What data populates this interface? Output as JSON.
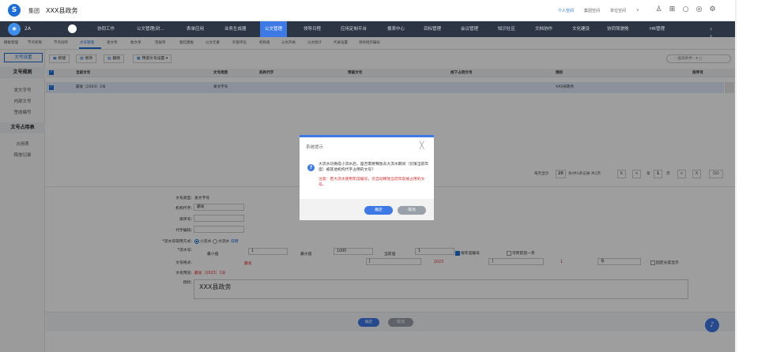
{
  "topbar": {
    "brand": "集团",
    "org": "XXX县政务",
    "links": [
      "个人空间",
      "集团空间",
      "单位空间"
    ],
    "dropdown": "∨"
  },
  "navbar": {
    "avatar": "2A",
    "items": [
      "协同工作",
      "公文管理(封...",
      "表单应用",
      "业务生成器",
      "公文管理",
      "领导日程",
      "应用定制平台",
      "报表中心",
      "目标管理",
      "会议管理",
      "知识社区",
      "文档协作",
      "文化建设",
      "协同驾驶舱",
      "HR管理"
    ],
    "active_index": 4,
    "arrows": "‹ ›"
  },
  "subtabs": {
    "items": [
      "模板管理",
      "节点权限",
      "节点动作",
      "文号管理",
      "发文单",
      "收文单",
      "签报单",
      "套红模板",
      "公文元素",
      "外部单位",
      "机构组",
      "公文开关",
      "公文统计",
      "代录设置",
      "领导批示编号"
    ],
    "active_index": 3
  },
  "sidebar": {
    "tab": "文号设置",
    "group1": "文号规则",
    "group1_items": [
      "发文字号",
      "内部文号",
      "签收编号"
    ],
    "group2": "文号占用表",
    "group2_items": [
      "占用表",
      "释放记录"
    ]
  },
  "toolbar": {
    "new": "新建",
    "edit": "修改",
    "delete": "删除",
    "preset": "预留文号设置",
    "search": "--查询条件--"
  },
  "table": {
    "headers": [
      "当前文号",
      "文号类型",
      "机构代字",
      "预留文号",
      "线下占用文号",
      "授权",
      "排序号"
    ],
    "rows": [
      [
        "霸发〔2023〕2号",
        "发文字号",
        "",
        "",
        "",
        "XXX县政务",
        ""
      ]
    ]
  },
  "pagination": {
    "per_page_label": "每页显示",
    "per_page": "20",
    "summary": "条/共1条记录 共1页",
    "first": "K",
    "prev": "<",
    "page_prefix": "第",
    "page": "1",
    "page_suffix": "页",
    "next": ">",
    "last": "X",
    "go": "GO"
  },
  "form": {
    "type_label": "文号类型:",
    "type_value": "发文字号",
    "org_label": "机构代字:",
    "org_value": "霸发",
    "sort_label": "排序号:",
    "sort_value": "",
    "code_label": "代字编码:",
    "code_value": "",
    "mode_label": "*流水号取用方式:",
    "mode_small": "小流水",
    "mode_big": "大流水",
    "mode_help": "说明",
    "serial_label": "*流水号:",
    "min_label": "最小值",
    "min_value": "1",
    "max_label": "最大值",
    "max_value": "1000",
    "cur_label": "当前值",
    "cur_value": "1",
    "yearly_label": "按年度编号",
    "skip_label": "可跨前后一年",
    "format_label": "文号格式:",
    "format_org": "霸发",
    "format_lb": "[",
    "format_year": "2023",
    "format_rb": "]",
    "format_num": "1",
    "format_suffix": "号",
    "fixlen_label": "固定长度显示",
    "preview_label": "文号预览:",
    "preview_value": "霸发〔2023〕1号",
    "auth_label": "授权:",
    "auth_value": "XXX县政务",
    "ok": "确定",
    "cancel": "取消"
  },
  "dialog": {
    "title": "系统提示",
    "close": "╳",
    "message": "大流水切换成小流水后，是否需要释放去大流水期间（仅限当前年度）被其他机构代字占用的文号？",
    "warning": "注意：若大流水使用年度编号，仅自动释放当前年度被占用的文号。",
    "ok": "确定",
    "cancel": "取消"
  }
}
